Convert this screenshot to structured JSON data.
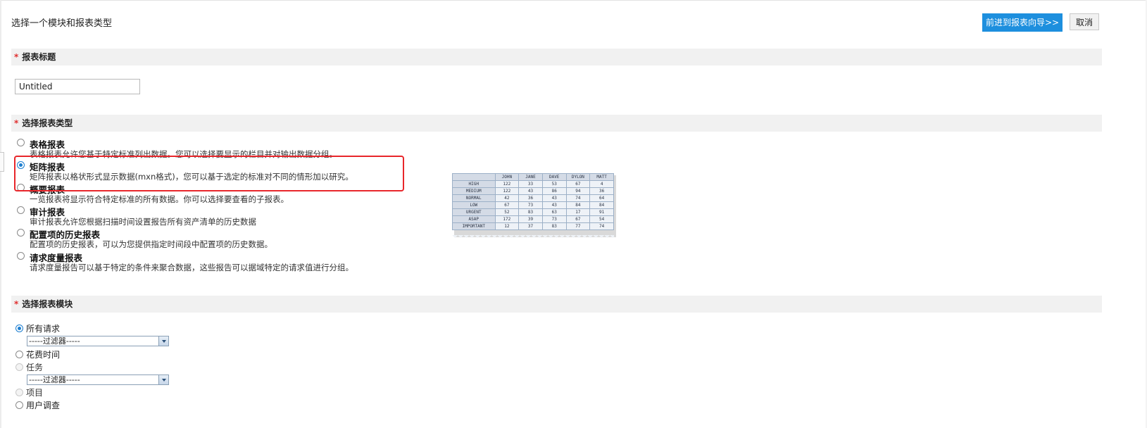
{
  "header": {
    "title": "选择一个模块和报表类型",
    "next_button": "前进到报表向导>>",
    "cancel_button": "取消"
  },
  "sections": {
    "report_title": {
      "required_mark": "*",
      "label": "报表标题",
      "input_value": "Untitled"
    },
    "report_type": {
      "required_mark": "*",
      "label": "选择报表类型"
    },
    "report_module": {
      "required_mark": "*",
      "label": "选择报表模块"
    }
  },
  "report_types": [
    {
      "name": "表格报表",
      "desc": "表格报表允许您基于特定标准列出数据。您可以选择要显示的栏目并对输出数据分组。",
      "checked": false
    },
    {
      "name": "矩阵报表",
      "desc": "矩阵报表以格状形式显示数据(mxn格式)，您可以基于选定的标准对不同的情形加以研究。",
      "checked": true
    },
    {
      "name": "概要报表",
      "desc": "一览报表将显示符合特定标准的所有数据。你可以选择要查看的子报表。",
      "checked": false
    },
    {
      "name": "审计报表",
      "desc": "审计报表允许您根据扫描时间设置报告所有资产清单的历史数据",
      "checked": false
    },
    {
      "name": "配置项的历史报表",
      "desc": "配置项的历史报表，可以为您提供指定时间段中配置项的历史数据。",
      "checked": false
    },
    {
      "name": "请求度量报表",
      "desc": "请求度量报告可以基于特定的条件来聚合数据，这些报告可以据域特定的请求值进行分组。",
      "checked": false
    }
  ],
  "preview_matrix": {
    "columns": [
      "JOHN",
      "JANE",
      "DAVE",
      "DYLON",
      "MATT"
    ],
    "rows": [
      {
        "label": "HIGH",
        "values": [
          "122",
          "33",
          "53",
          "67",
          "4"
        ]
      },
      {
        "label": "MEDIUM",
        "values": [
          "122",
          "43",
          "86",
          "94",
          "36"
        ]
      },
      {
        "label": "NORMAL",
        "values": [
          "42",
          "36",
          "43",
          "74",
          "64"
        ]
      },
      {
        "label": "LOW",
        "values": [
          "67",
          "73",
          "43",
          "84",
          "84"
        ]
      },
      {
        "label": "URGENT",
        "values": [
          "52",
          "83",
          "63",
          "17",
          "91"
        ]
      },
      {
        "label": "ASAP",
        "values": [
          "172",
          "39",
          "73",
          "67",
          "54"
        ]
      },
      {
        "label": "IMPORTANT",
        "values": [
          "12",
          "37",
          "83",
          "77",
          "74"
        ]
      }
    ]
  },
  "modules": [
    {
      "label": "所有请求",
      "checked": true,
      "disabled": false,
      "filter": "-----过滤器-----"
    },
    {
      "label": "花费时间",
      "checked": false,
      "disabled": false
    },
    {
      "label": "任务",
      "checked": false,
      "disabled": true,
      "filter": "-----过滤器-----"
    },
    {
      "label": "项目",
      "checked": false,
      "disabled": true
    },
    {
      "label": "用户调查",
      "checked": false,
      "disabled": false
    }
  ]
}
